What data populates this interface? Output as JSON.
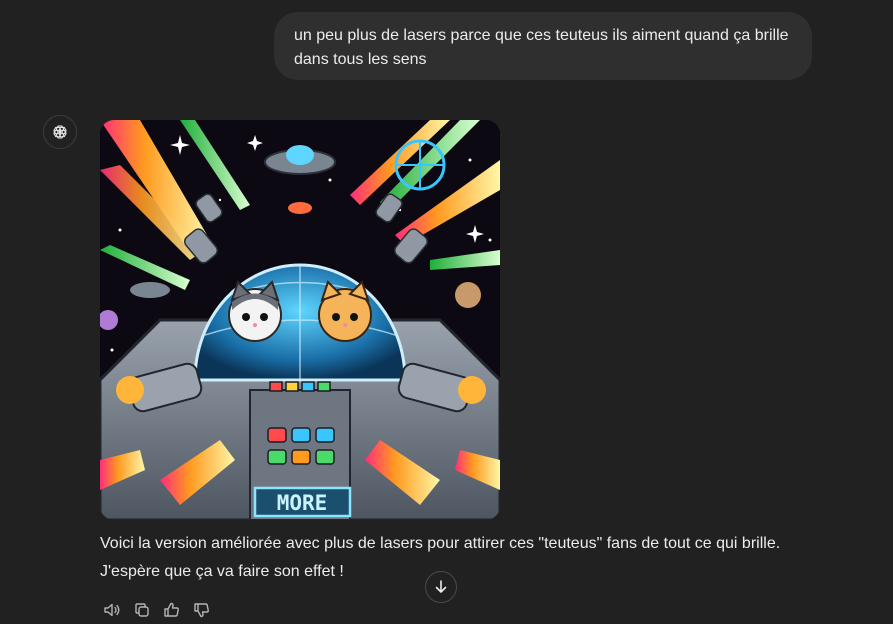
{
  "conversation": {
    "user_message": {
      "lines": [
        "un peu plus de lasers parce que ces teuteus ils aiment quand ça brille",
        "dans tous les sens"
      ]
    },
    "assistant_message": {
      "avatar_icon": "openai-logo-icon",
      "image": {
        "panel_label": "MORE"
      },
      "lines": [
        "Voici la version améliorée avec plus de lasers pour attirer ces \"teuteus\" fans de tout ce qui brille.",
        "J'espère que ça va faire son effet !"
      ]
    }
  },
  "actions": {
    "read_aloud_icon": "speaker-icon",
    "copy_icon": "copy-icon",
    "thumbs_up_icon": "thumbs-up-icon",
    "thumbs_down_icon": "thumbs-down-icon",
    "scroll_icon": "arrow-down-icon"
  },
  "colors": {
    "background": "#212121",
    "user_bubble": "#2f2f2f",
    "text": "#ececec",
    "icon": "#b4b4b4"
  }
}
